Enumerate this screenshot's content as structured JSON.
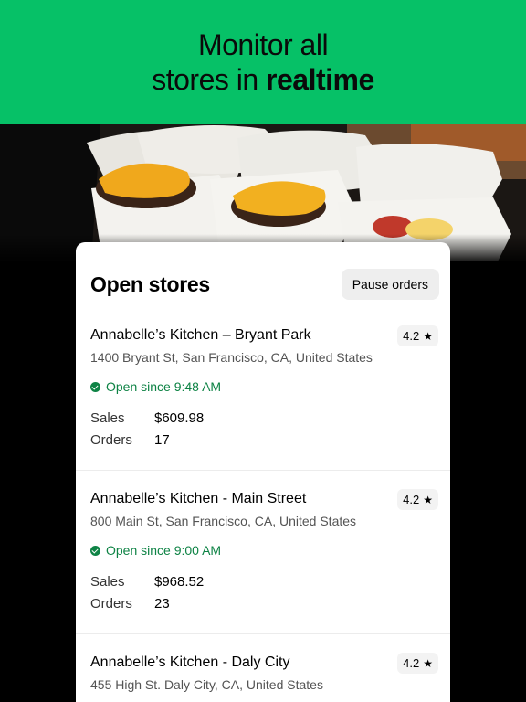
{
  "banner": {
    "line1": "Monitor all",
    "line2_regular": "stores in ",
    "line2_bold": "realtime"
  },
  "card": {
    "title": "Open stores",
    "pause_label": "Pause orders"
  },
  "stores": [
    {
      "name": "Annabelle’s Kitchen – Bryant Park",
      "rating": "4.2",
      "address": "1400 Bryant St, San Francisco, CA, United States",
      "open": "Open since 9:48 AM",
      "sales_label": "Sales",
      "sales": "$609.98",
      "orders_label": "Orders",
      "orders": "17"
    },
    {
      "name": "Annabelle’s Kitchen - Main Street",
      "rating": "4.2",
      "address": "800 Main St, San Francisco, CA, United States",
      "open": "Open since 9:00 AM",
      "sales_label": "Sales",
      "sales": "$968.52",
      "orders_label": "Orders",
      "orders": "23"
    },
    {
      "name": "Annabelle’s Kitchen - Daly City",
      "rating": "4.2",
      "address": "455 High St. Daly City, CA, United States"
    }
  ],
  "colors": {
    "brand_green": "#06c167",
    "open_green": "#0e8345"
  },
  "icons": {
    "rating": "star-icon",
    "open": "check-circle-icon"
  }
}
